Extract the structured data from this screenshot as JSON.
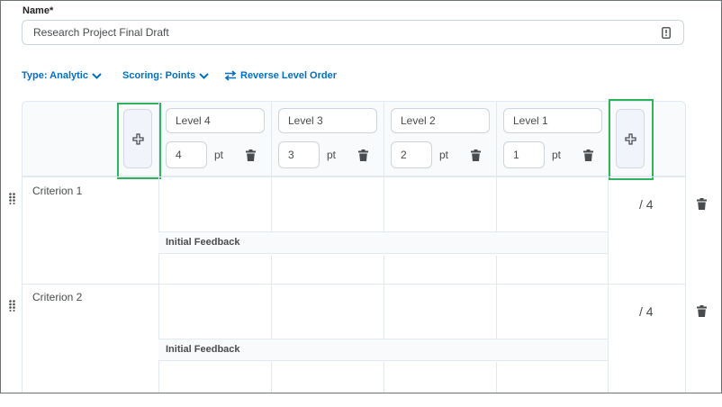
{
  "name_field": {
    "label": "Name*",
    "value": "Research Project Final Draft"
  },
  "toolbar": {
    "type_label": "Type: Analytic",
    "scoring_label": "Scoring: Points",
    "reverse_label": "Reverse Level Order"
  },
  "levels": [
    {
      "name": "Level 4",
      "points": "4",
      "unit": "pt"
    },
    {
      "name": "Level 3",
      "points": "3",
      "unit": "pt"
    },
    {
      "name": "Level 2",
      "points": "2",
      "unit": "pt"
    },
    {
      "name": "Level 1",
      "points": "1",
      "unit": "pt"
    }
  ],
  "criteria": [
    {
      "name": "Criterion 1",
      "feedback_label": "Initial Feedback",
      "score": "/ 4"
    },
    {
      "name": "Criterion 2",
      "feedback_label": "Initial Feedback",
      "score": "/ 4"
    }
  ],
  "colors": {
    "accent": "#006fbf",
    "highlight": "#2fb35c"
  }
}
